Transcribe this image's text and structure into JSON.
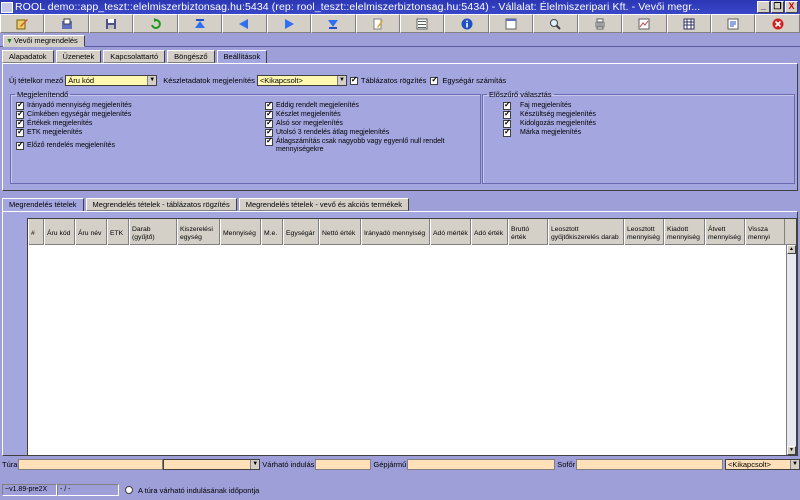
{
  "window": {
    "title": "ROOL demo::app_teszt::elelmiszerbiztonsag.hu:5434 (rep: rool_teszt::elelmiszerbiztonsag.hu:5434) - Vállalat: Élelmiszeripari Kft. - Vevői megr...",
    "buttons": {
      "minimize": "_",
      "restore": "❐",
      "close": "X"
    }
  },
  "toolbar": {
    "icons": [
      "edit-icon",
      "open-icon",
      "save-icon",
      "refresh-icon",
      "first-icon",
      "prev-icon",
      "next-icon",
      "last-icon",
      "pencil-icon",
      "list-icon",
      "info-icon",
      "window-icon",
      "search-icon",
      "print-icon",
      "chart-icon",
      "table-icon",
      "export-icon",
      "cancel-icon"
    ]
  },
  "doc_tab": {
    "label": "Vevői megrendelés"
  },
  "upper_tabs": [
    "Alapadatok",
    "Üzenetek",
    "Kapcsolattartó",
    "Böngésző",
    "Beállítások"
  ],
  "upper_active": "Beállítások",
  "settings": {
    "new_item_field_label": "Új tételkor mező",
    "new_item_field_value": "Áru kód",
    "stock_display_label": "Készletadatok megjelenítés",
    "stock_display_value": "<Kikapcsolt>",
    "tabular_entry_label": "Táblázatos rögzítés",
    "tabular_entry_checked": true,
    "unit_price_calc_label": "Egységár számítás",
    "unit_price_calc_checked": true,
    "display_group": {
      "legend": "Megjelenítendő",
      "left": [
        {
          "label": "Irányadó mennyiség megjelenítés",
          "checked": true
        },
        {
          "label": "Címkében egységár megjelenítés",
          "checked": true
        },
        {
          "label": "Értékek megjelenítés",
          "checked": true
        },
        {
          "label": "ETK megjelenítés",
          "checked": true
        },
        {
          "label": "Előző rendelés megjelenítés",
          "checked": true
        }
      ],
      "right": [
        {
          "label": "Eddig rendelt megjelenítés",
          "checked": true
        },
        {
          "label": "Készlet megjelenítés",
          "checked": true
        },
        {
          "label": "Alsó sor megjelenítés",
          "checked": true
        },
        {
          "label": "Utolsó 3 rendelés átlag megjelenítés",
          "checked": true
        },
        {
          "label": "Átlagszámítás csak nagyobb vagy egyenlő null rendelt mennyiségekre",
          "checked": true
        }
      ]
    },
    "preselect_group": {
      "legend": "Előszűrő választás",
      "items": [
        {
          "label": "Faj megjelenítés",
          "checked": true
        },
        {
          "label": "Készültség megjelenítés",
          "checked": true
        },
        {
          "label": "Kidolgozás megjelenítés",
          "checked": true
        },
        {
          "label": "Márka megjelenítés",
          "checked": true
        }
      ]
    }
  },
  "lower_tabs": [
    "Megrendelés tételek",
    "Megrendelés tételek - táblázatos rögzítés",
    "Megrendelés tételek - vevő és akciós termékek"
  ],
  "lower_active": "Megrendelés tételek",
  "grid": {
    "columns": [
      "#",
      "Áru kód",
      "Áru név",
      "ETK",
      "Darab (gyűjtő)",
      "Kiszerelési egység",
      "Mennyiség",
      "M.e.",
      "Egységár",
      "Nettó érték",
      "Irányadó mennyiség",
      "Adó mérték",
      "Adó érték",
      "Bruttó érték",
      "Leosztott gyűjtőkiszerelés darab",
      "Leosztott mennyiség",
      "Kiadott mennyiség",
      "Átvett mennyiség",
      "Vissza mennyi"
    ]
  },
  "filter": {
    "route_label": "Túra",
    "expected_start_label": "Várható indulás",
    "vehicle_label": "Gépjármű",
    "driver_label": "Sofőr",
    "driver_select_value": "<Kikapcsolt>"
  },
  "status": {
    "version": "~v1.89-pre2X",
    "dashes": "- / -",
    "radio_label": "A túra várható indulásának időpontja"
  }
}
